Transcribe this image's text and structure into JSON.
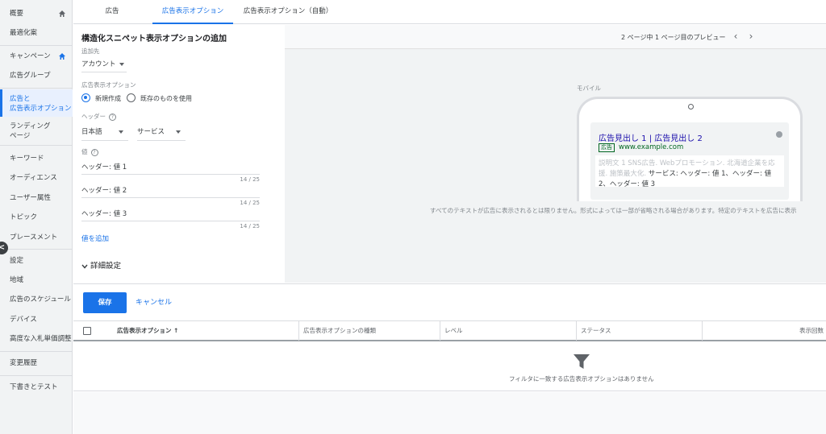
{
  "sidebar": {
    "items": [
      {
        "label": "概要"
      },
      {
        "label": "最適化案"
      },
      {
        "label": "キャンペーン"
      },
      {
        "label": "広告グループ"
      },
      {
        "label": "広告と\n広告表示オプション"
      },
      {
        "label": "ランディング\nページ"
      },
      {
        "label": "キーワード"
      },
      {
        "label": "オーディエンス"
      },
      {
        "label": "ユーザー属性"
      },
      {
        "label": "トピック"
      },
      {
        "label": "プレースメント"
      },
      {
        "label": "設定"
      },
      {
        "label": "地域"
      },
      {
        "label": "広告のスケジュール"
      },
      {
        "label": "デバイス"
      },
      {
        "label": "高度な入札単価調整"
      },
      {
        "label": "変更履歴"
      },
      {
        "label": "下書きとテスト"
      }
    ],
    "collapse_icon": "<"
  },
  "tabs": [
    {
      "label": "広告"
    },
    {
      "label": "広告表示オプション"
    },
    {
      "label": "広告表示オプション（自動）"
    }
  ],
  "form": {
    "title": "構造化スニペット表示オプションの追加",
    "add_to_label": "追加先",
    "add_to_value": "アカウント",
    "extension_label": "広告表示オプション",
    "radio_new": "新規作成",
    "radio_existing": "既存のものを使用",
    "header_label": "ヘッダー",
    "language_value": "日本語",
    "header_value": "サービス",
    "values_label": "値",
    "values": [
      {
        "text": "ヘッダー: 値 1",
        "counter": "14 / 25"
      },
      {
        "text": "ヘッダー: 値 2",
        "counter": "14 / 25"
      },
      {
        "text": "ヘッダー: 値 3",
        "counter": "14 / 25"
      }
    ],
    "add_value_link": "値を追加",
    "advanced_label": "詳細設定",
    "help_glyph": "?"
  },
  "preview": {
    "page_text": "2 ページ中 1 ページ目のプレビュー",
    "prev_arrow": "‹",
    "next_arrow": "›",
    "mobile_label": "モバイル",
    "ad": {
      "headline": "広告見出し 1 | 広告見出し 2",
      "badge": "広告",
      "url": "www.example.com",
      "desc_grey": "説明文 1 SNS広告. Webプロモーション. 北海道企業を応援. 施策最大化.",
      "desc_main": "サービス: ヘッダー: 値 1、ヘッダー: 値 2、ヘッダー: 値 3"
    },
    "note": "すべてのテキストが広告に表示されるとは限りません。形式によっては一部が省略される場合があります。特定のテキストを広告に表示"
  },
  "actions": {
    "save_label": "保存",
    "cancel_label": "キャンセル"
  },
  "table": {
    "columns": [
      {
        "label": "広告表示オプション ↑"
      },
      {
        "label": "広告表示オプションの種類"
      },
      {
        "label": "レベル"
      },
      {
        "label": "ステータス"
      },
      {
        "label": "表示回数"
      }
    ],
    "empty_text": "フィルタに一致する広告表示オプションはありません"
  },
  "colors": {
    "accent": "#1a73e8",
    "ad_green": "#006621",
    "ad_link": "#1a0dab"
  }
}
